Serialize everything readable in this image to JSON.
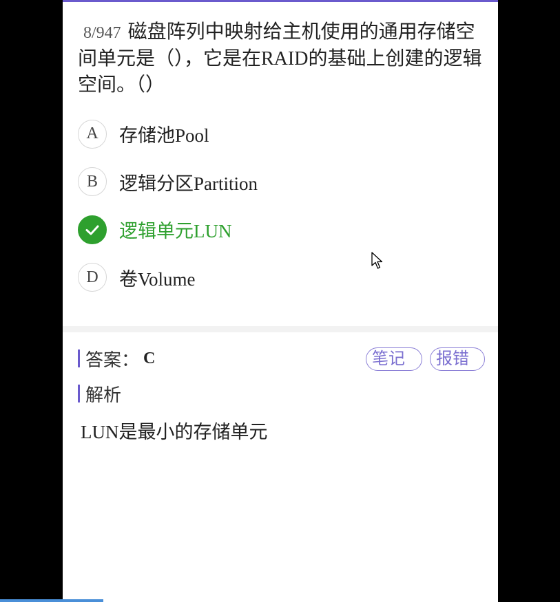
{
  "question": {
    "number": "8/947",
    "text": "磁盘阵列中映射给主机使用的通用存储空间单元是（），它是在RAID的基础上创建的逻辑空间。（）"
  },
  "options": [
    {
      "letter": "A",
      "text": "存储池Pool",
      "correct": false
    },
    {
      "letter": "B",
      "text": "逻辑分区Partition",
      "correct": false
    },
    {
      "letter": "C",
      "text": "逻辑单元LUN",
      "correct": true
    },
    {
      "letter": "D",
      "text": "卷Volume",
      "correct": false
    }
  ],
  "answer": {
    "label": "答案：",
    "value": "C"
  },
  "buttons": {
    "notes": "笔记",
    "report": "报错"
  },
  "analysis": {
    "label": "解析",
    "text": "LUN是最小的存储单元"
  },
  "colors": {
    "accent": "#6a5acd",
    "correct": "#2ea02e"
  },
  "icons": {
    "correct_option": "check-icon",
    "pointer": "mouse-cursor-icon"
  }
}
